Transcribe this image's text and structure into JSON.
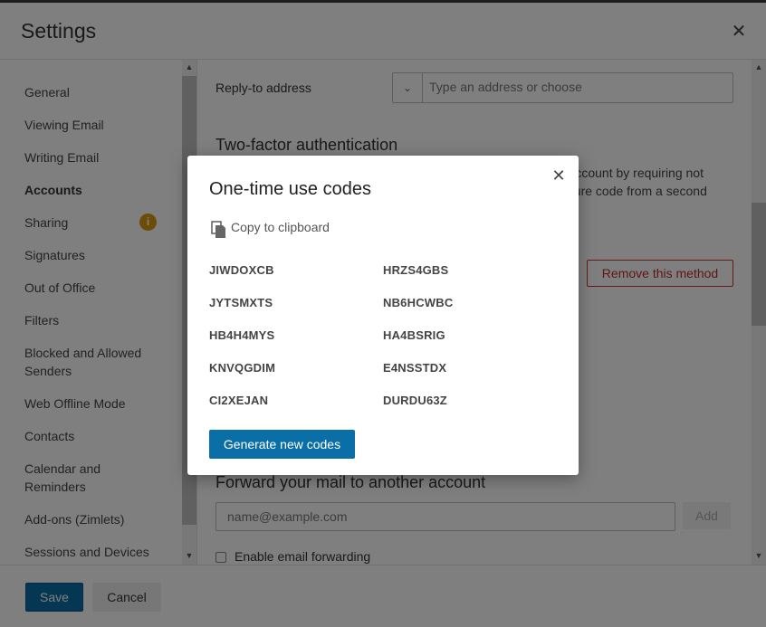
{
  "header": {
    "title": "Settings",
    "close_icon": "close-icon"
  },
  "sidebar": {
    "items": [
      {
        "label": "General"
      },
      {
        "label": "Viewing Email"
      },
      {
        "label": "Writing Email"
      },
      {
        "label": "Accounts",
        "active": true
      },
      {
        "label": "Sharing",
        "badge": "i"
      },
      {
        "label": "Signatures"
      },
      {
        "label": "Out of Office"
      },
      {
        "label": "Filters"
      },
      {
        "label": "Blocked and Allowed\nSenders"
      },
      {
        "label": "Web Offline Mode"
      },
      {
        "label": "Contacts"
      },
      {
        "label": "Calendar and\nReminders"
      },
      {
        "label": "Add-ons (Zimlets)"
      },
      {
        "label": "Sessions and Devices"
      }
    ]
  },
  "main": {
    "reply_to": {
      "label": "Reply-to address",
      "placeholder": "Type an address or choose",
      "value": ""
    },
    "two_factor": {
      "title": "Two-factor authentication",
      "desc_line1": "r account by requiring not",
      "desc_line2": "ecure code from a second",
      "remove_button": "Remove this method"
    },
    "forward": {
      "title": "Forward your mail to another account",
      "placeholder": "name@example.com",
      "value": "",
      "add_button": "Add",
      "enable_label": "Enable email forwarding",
      "enable_checked": false
    }
  },
  "footer": {
    "save": "Save",
    "cancel": "Cancel"
  },
  "modal": {
    "title": "One-time use codes",
    "copy_label": "Copy to clipboard",
    "codes_left": [
      "JIWDOXCB",
      "JYTSMXTS",
      "HB4H4MYS",
      "KNVQGDIM",
      "CI2XEJAN"
    ],
    "codes_right": [
      "HRZS4GBS",
      "NB6HCWBC",
      "HA4BSRIG",
      "E4NSSTDX",
      "DURDU63Z"
    ],
    "generate_button": "Generate new codes"
  },
  "colors": {
    "accent": "#0a6ea7",
    "danger": "#c62828",
    "badge": "#d99a11"
  }
}
